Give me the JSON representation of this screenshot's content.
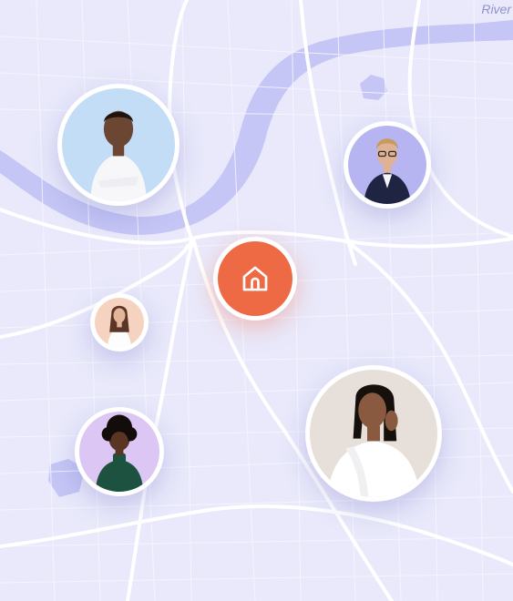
{
  "map": {
    "river_label": "River",
    "colors": {
      "background": "#e9e9fb",
      "roads": "#ffffff",
      "water": "#c5c6f5",
      "home_accent": "#ee6a44"
    }
  },
  "home_marker": {
    "icon": "home-icon"
  },
  "people": [
    {
      "id": "person-man-white-shirt",
      "bg": "#c3ddf6",
      "skin": "#6b4632",
      "hair": "#1e1410",
      "shirt": "#f7f7f9"
    },
    {
      "id": "person-man-navy-blazer",
      "bg": "#b6b5f2",
      "skin": "#e0b294",
      "hair": "#c79a5e",
      "shirt": "#1f2443"
    },
    {
      "id": "person-woman-white-top",
      "bg": "#f6d3c0",
      "skin": "#e3b699",
      "hair": "#5a3626",
      "shirt": "#fdfdfd"
    },
    {
      "id": "person-woman-green-sweater",
      "bg": "#dcc6f4",
      "skin": "#5a3524",
      "hair": "#120c0a",
      "shirt": "#1d5240"
    },
    {
      "id": "person-woman-white-robe",
      "bg": "#e6dfda",
      "skin": "#8a5a40",
      "hair": "#16100d",
      "shirt": "#ffffff"
    }
  ]
}
